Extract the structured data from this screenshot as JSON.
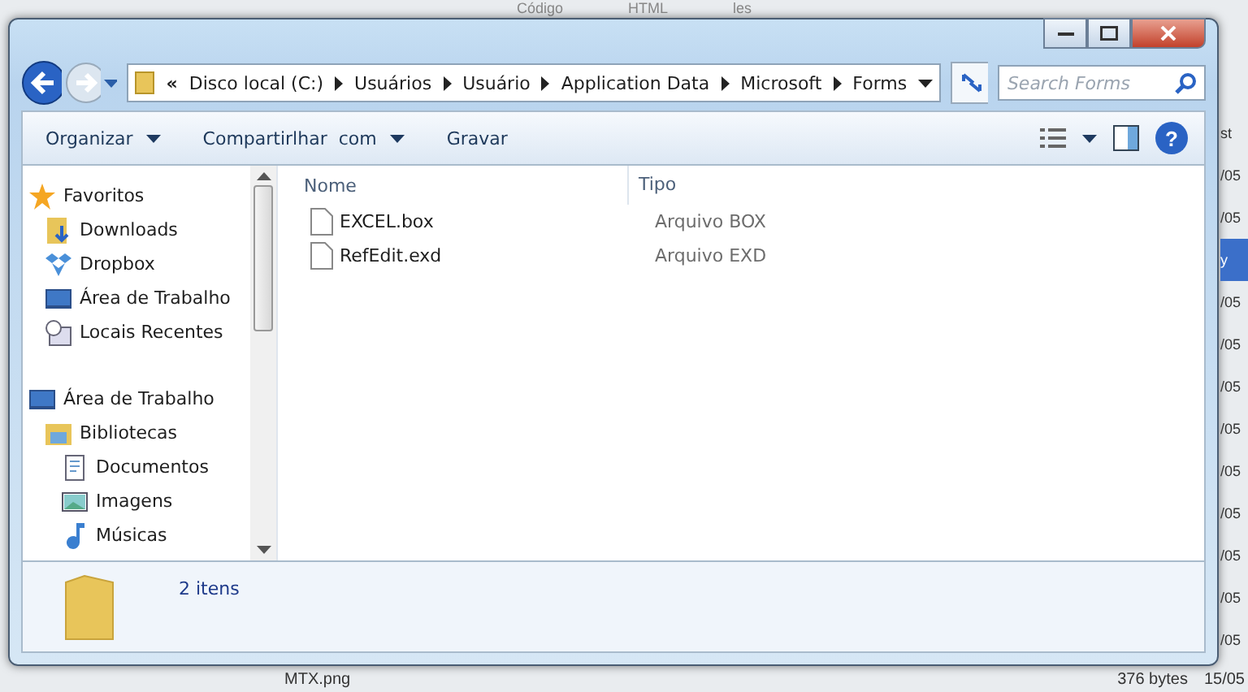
{
  "background_window": {
    "header": [
      "Código",
      "HTML",
      "les"
    ],
    "side_rows": [
      {
        "text": "st",
        "selected": false
      },
      {
        "text": "/05",
        "selected": false
      },
      {
        "text": "/05",
        "selected": false
      },
      {
        "text": "y",
        "selected": true
      },
      {
        "text": "/05",
        "selected": false
      },
      {
        "text": "/05",
        "selected": false
      },
      {
        "text": "/05",
        "selected": false
      },
      {
        "text": "/05",
        "selected": false
      },
      {
        "text": "/05",
        "selected": false
      },
      {
        "text": "/05",
        "selected": false
      },
      {
        "text": "/05",
        "selected": false
      },
      {
        "text": "/05",
        "selected": false
      },
      {
        "text": "/05",
        "selected": false
      }
    ],
    "bottom_row": [
      "MTX.png",
      "376 bytes",
      "15/05"
    ]
  },
  "address_bar": {
    "overflow": "«",
    "crumbs": [
      "Disco local (C:)",
      "Usuários",
      "Usuário",
      "Application Data",
      "Microsoft",
      "Forms"
    ]
  },
  "search": {
    "placeholder": "Search Forms"
  },
  "toolbar": [
    {
      "label": "Organizar",
      "dropdown": true
    },
    {
      "label": "Compartirlhar  com",
      "dropdown": true
    },
    {
      "label": "Gravar",
      "dropdown": false
    }
  ],
  "help_button": "?",
  "nav_pane": [
    {
      "label": "Favoritos",
      "kind": "star",
      "children": [
        {
          "label": "Downloads",
          "kind": "downloads"
        },
        {
          "label": "Dropbox",
          "kind": "dropbox"
        },
        {
          "label": "Área de Trabalho",
          "kind": "desktop"
        },
        {
          "label": "Locais Recentes",
          "kind": "recent"
        }
      ]
    },
    {
      "label": "Área de Trabalho",
      "kind": "desktop",
      "children": [
        {
          "label": "Bibliotecas",
          "kind": "library",
          "children": [
            {
              "label": "Documentos",
              "kind": "document"
            },
            {
              "label": "Imagens",
              "kind": "image"
            },
            {
              "label": "Músicas",
              "kind": "music"
            }
          ]
        }
      ]
    }
  ],
  "file_list": {
    "columns": [
      "Nome",
      "Tipo"
    ],
    "rows": [
      {
        "name": "EXCEL.box",
        "type": "Arquivo BOX"
      },
      {
        "name": "RefEdit.exd",
        "type": "Arquivo EXD"
      }
    ]
  },
  "status_bar": {
    "count": "2 itens"
  }
}
